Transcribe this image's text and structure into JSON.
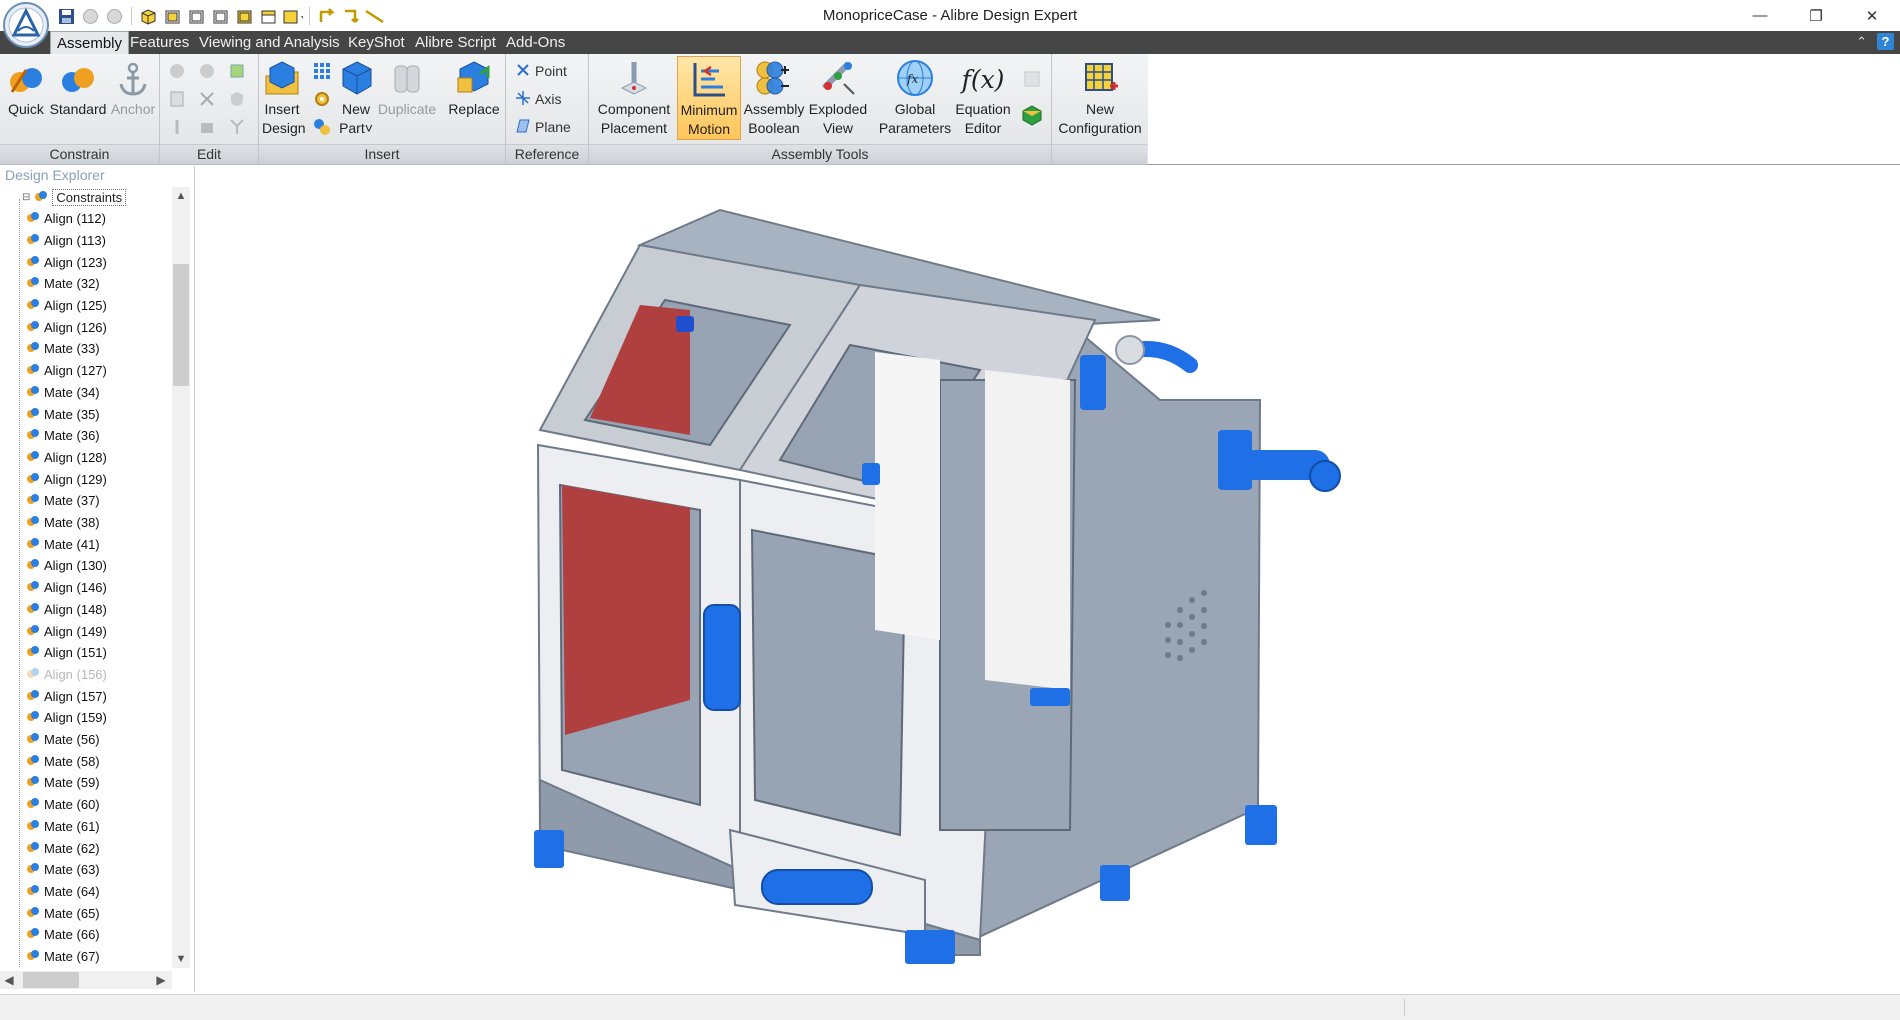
{
  "window": {
    "title": "MonopriceCase - Alibre Design Expert",
    "minimize": "—",
    "restore": "❐",
    "close": "✕"
  },
  "menu": {
    "tabs": [
      "Assembly",
      "Features",
      "Viewing and Analysis",
      "KeyShot",
      "Alibre Script",
      "Add-Ons"
    ],
    "active": "Assembly",
    "help": "?"
  },
  "ribbon": {
    "groups": {
      "constrain": "Constrain",
      "edit": "Edit",
      "insert": "Insert",
      "reference": "Reference",
      "assembly_tools": "Assembly Tools"
    },
    "buttons": {
      "quick": "Quick",
      "standard": "Standard",
      "anchor": "Anchor",
      "insert_design_1": "Insert",
      "insert_design_2": "Design",
      "new_part_1": "New",
      "new_part_2": "Part˅",
      "duplicate": "Duplicate",
      "replace": "Replace",
      "point": "Point",
      "axis": "Axis",
      "plane": "Plane",
      "component_placement_1": "Component",
      "component_placement_2": "Placement",
      "minimum_motion_1": "Minimum",
      "minimum_motion_2": "Motion",
      "assembly_boolean_1": "Assembly",
      "assembly_boolean_2": "Boolean",
      "exploded_view_1": "Exploded",
      "exploded_view_2": "View",
      "global_parameters_1": "Global",
      "global_parameters_2": "Parameters",
      "equation_editor_1": "Equation",
      "equation_editor_2": "Editor",
      "equation_icon": "f(x)",
      "new_configuration_1": "New",
      "new_configuration_2": "Configuration"
    }
  },
  "explorer": {
    "title": "Design Explorer",
    "root": "Constraints",
    "items": [
      {
        "label": "Align (112)",
        "suppressed": false
      },
      {
        "label": "Align (113)",
        "suppressed": false
      },
      {
        "label": "Align (123)",
        "suppressed": false
      },
      {
        "label": "Mate (32)",
        "suppressed": false
      },
      {
        "label": "Align (125)",
        "suppressed": false
      },
      {
        "label": "Align (126)",
        "suppressed": false
      },
      {
        "label": "Mate (33)",
        "suppressed": false
      },
      {
        "label": "Align (127)",
        "suppressed": false
      },
      {
        "label": "Mate (34)",
        "suppressed": false
      },
      {
        "label": "Mate (35)",
        "suppressed": false
      },
      {
        "label": "Mate (36)",
        "suppressed": false
      },
      {
        "label": "Align (128)",
        "suppressed": false
      },
      {
        "label": "Align (129)",
        "suppressed": false
      },
      {
        "label": "Mate (37)",
        "suppressed": false
      },
      {
        "label": "Mate (38)",
        "suppressed": false
      },
      {
        "label": "Mate (41)",
        "suppressed": false
      },
      {
        "label": "Align (130)",
        "suppressed": false
      },
      {
        "label": "Align (146)",
        "suppressed": false
      },
      {
        "label": "Align (148)",
        "suppressed": false
      },
      {
        "label": "Align (149)",
        "suppressed": false
      },
      {
        "label": "Align (151)",
        "suppressed": false
      },
      {
        "label": "Align (156)",
        "suppressed": true
      },
      {
        "label": "Align (157)",
        "suppressed": false
      },
      {
        "label": "Align (159)",
        "suppressed": false
      },
      {
        "label": "Mate (56)",
        "suppressed": false
      },
      {
        "label": "Mate (58)",
        "suppressed": false
      },
      {
        "label": "Mate (59)",
        "suppressed": false
      },
      {
        "label": "Mate (60)",
        "suppressed": false
      },
      {
        "label": "Mate (61)",
        "suppressed": false
      },
      {
        "label": "Mate (62)",
        "suppressed": false
      },
      {
        "label": "Mate (63)",
        "suppressed": false
      },
      {
        "label": "Mate (64)",
        "suppressed": false
      },
      {
        "label": "Mate (65)",
        "suppressed": false
      },
      {
        "label": "Mate (66)",
        "suppressed": false
      },
      {
        "label": "Mate (67)",
        "suppressed": false
      }
    ]
  },
  "colors": {
    "accent_blue": "#1f6fe6",
    "red_panel": "#b04040",
    "body_gray": "#9aa6b5",
    "menubar": "#464646",
    "active_button": "#ffc55a"
  },
  "icons": {
    "constraint": "constraint-icon",
    "app": "alibre-logo-icon"
  }
}
